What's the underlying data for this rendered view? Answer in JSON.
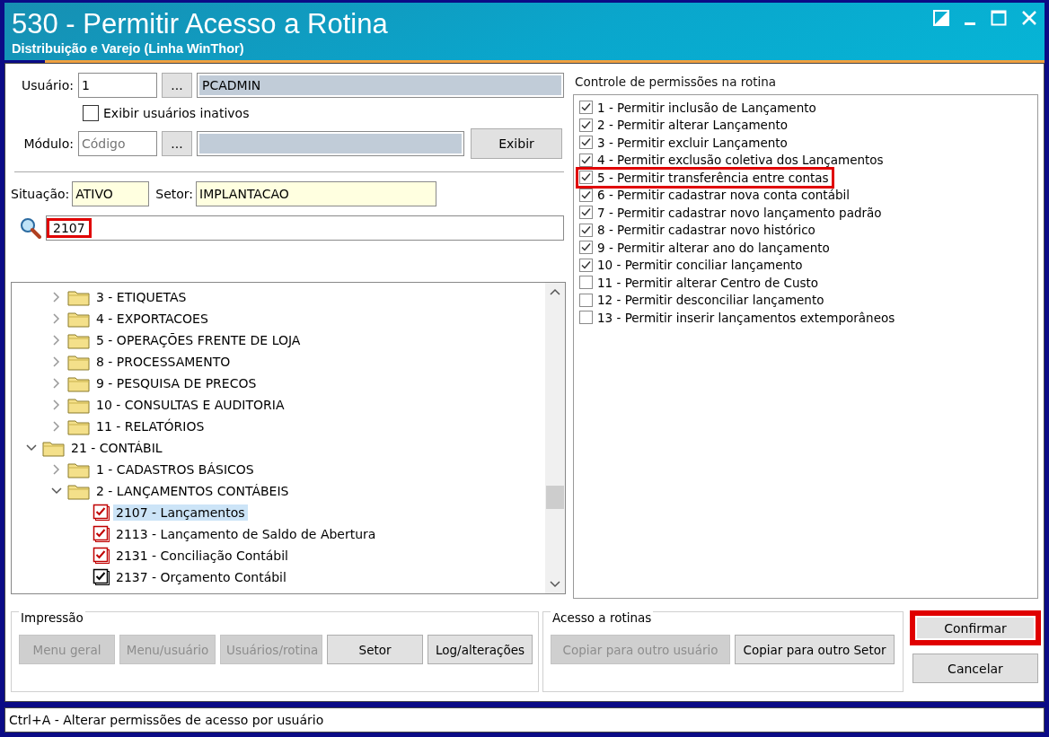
{
  "window": {
    "title": "530 - Permitir Acesso a Rotina",
    "subtitle": "Distribuição e Varejo (Linha WinThor)"
  },
  "user": {
    "label": "Usuário:",
    "code": "1",
    "browse": "...",
    "name": "PCADMIN"
  },
  "show_inactive": {
    "label": "Exibir usuários inativos",
    "checked": false
  },
  "module": {
    "label": "Módulo:",
    "placeholder": "Código",
    "browse": "...",
    "button": "Exibir"
  },
  "status": {
    "label": "Situação:",
    "value": "ATIVO"
  },
  "sector": {
    "label": "Setor:",
    "value": "IMPLANTACAO"
  },
  "search": {
    "value": "2107",
    "highlighted": true
  },
  "tree": {
    "continued_children": [
      {
        "label": "3 - ETIQUETAS",
        "kind": "folder",
        "expanded": false
      },
      {
        "label": "4 - EXPORTACOES",
        "kind": "folder",
        "expanded": false
      },
      {
        "label": "5 - OPERAÇÕES FRENTE DE LOJA",
        "kind": "folder",
        "expanded": false
      },
      {
        "label": "8 - PROCESSAMENTO",
        "kind": "folder",
        "expanded": false
      },
      {
        "label": "9 - PESQUISA DE PRECOS",
        "kind": "folder",
        "expanded": false
      },
      {
        "label": "10 - CONSULTAS E AUDITORIA",
        "kind": "folder",
        "expanded": false
      },
      {
        "label": "11 - RELATÓRIOS",
        "kind": "folder",
        "expanded": false
      }
    ],
    "items": [
      {
        "label": "21 - CONTÁBIL",
        "kind": "folder",
        "expanded": true,
        "children": [
          {
            "label": "1 - CADASTROS BÁSICOS",
            "kind": "folder",
            "expanded": false
          },
          {
            "label": "2 - LANÇAMENTOS CONTÁBEIS",
            "kind": "folder",
            "expanded": true,
            "children": [
              {
                "label": "2107 - Lançamentos",
                "kind": "routine",
                "checked": true,
                "color": "#c00000",
                "selected": true
              },
              {
                "label": "2113 - Lançamento de Saldo de Abertura",
                "kind": "routine",
                "checked": true,
                "color": "#c00000",
                "selected": false
              },
              {
                "label": "2131 - Conciliação Contábil",
                "kind": "routine",
                "checked": true,
                "color": "#c00000",
                "selected": false
              },
              {
                "label": "2137 - Orçamento Contábil",
                "kind": "routine",
                "checked": true,
                "color": "#000000",
                "selected": false
              }
            ]
          }
        ]
      }
    ]
  },
  "permissions": {
    "title": "Controle de permissões na rotina",
    "items": [
      {
        "label": "1 - Permitir inclusão de Lançamento",
        "checked": true,
        "highlighted": false
      },
      {
        "label": "2 - Permitir alterar Lançamento",
        "checked": true,
        "highlighted": false
      },
      {
        "label": "3 - Permitir excluir Lançamento",
        "checked": true,
        "highlighted": false
      },
      {
        "label": "4 - Permitir exclusão coletiva dos Lançamentos",
        "checked": true,
        "highlighted": false
      },
      {
        "label": "5 - Permitir transferência entre contas",
        "checked": true,
        "highlighted": true
      },
      {
        "label": "6 - Permitir cadastrar nova conta contábil",
        "checked": true,
        "highlighted": false
      },
      {
        "label": "7 - Permitir cadastrar novo lançamento padrão",
        "checked": true,
        "highlighted": false
      },
      {
        "label": "8 - Permitir cadastrar novo histórico",
        "checked": true,
        "highlighted": false
      },
      {
        "label": "9 - Permitir alterar ano do lançamento",
        "checked": true,
        "highlighted": false
      },
      {
        "label": "10 - Permitir conciliar lançamento",
        "checked": true,
        "highlighted": false
      },
      {
        "label": "11 - Permitir alterar Centro de Custo",
        "checked": false,
        "highlighted": false
      },
      {
        "label": "12 - Permitir desconciliar lançamento",
        "checked": false,
        "highlighted": false
      },
      {
        "label": "13 - Permitir inserir lançamentos extemporâneos",
        "checked": false,
        "highlighted": false
      }
    ]
  },
  "print_group": {
    "title": "Impressão",
    "buttons": [
      {
        "label": "Menu geral",
        "disabled": true
      },
      {
        "label": "Menu/usuário",
        "disabled": true
      },
      {
        "label": "Usuários/rotina",
        "disabled": true
      },
      {
        "label": "Setor",
        "disabled": false
      },
      {
        "label": "Log/alterações",
        "disabled": false
      }
    ]
  },
  "access_group": {
    "title": "Acesso a rotinas",
    "buttons": [
      {
        "label": "Copiar para outro usuário",
        "disabled": true
      },
      {
        "label": "Copiar para outro Setor",
        "disabled": false
      }
    ]
  },
  "actions": [
    {
      "label": "Confirmar",
      "highlighted": true
    },
    {
      "label": "Cancelar",
      "highlighted": false
    }
  ],
  "status_bar": "Ctrl+A - Alterar permissões de acesso por usuário"
}
